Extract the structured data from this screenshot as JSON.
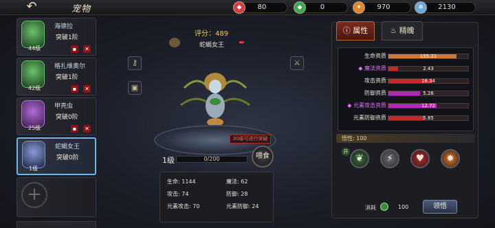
{
  "header": {
    "title": "宠物",
    "back_icon": "back-arrow-icon"
  },
  "resources": [
    {
      "icon": "red-gem-icon",
      "color": "#d93b3b",
      "value": "80"
    },
    {
      "icon": "green-gem-icon",
      "color": "#3ea84a",
      "value": "0"
    },
    {
      "icon": "flame-icon",
      "color": "#e0872a",
      "value": "970"
    },
    {
      "icon": "snowflake-icon",
      "color": "#6aa9d8",
      "value": "2130"
    }
  ],
  "pets": [
    {
      "name": "海德拉",
      "level": "44级",
      "break": "突破1阶",
      "avatar": "green"
    },
    {
      "name": "格扎维奥尔",
      "level": "42级",
      "break": "突破1阶",
      "avatar": "green"
    },
    {
      "name": "甲壳虫",
      "level": "25级",
      "break": "突破0阶",
      "avatar": "purple"
    },
    {
      "name": "蛇蝎女王",
      "level": "1级",
      "break": "突破0阶",
      "avatar": "blue"
    }
  ],
  "center": {
    "score": "评分：489",
    "pet_name": "蛇蝎女王",
    "breakthrough_tag": "30级可进行突破",
    "level": "1级",
    "exp": "0/200",
    "feed_label": "喂食"
  },
  "stats": {
    "hp": "生命: 1144",
    "mp": "魔法: 62",
    "atk": "攻击: 74",
    "def": "防御: 28",
    "elem_atk": "元素攻击: 70",
    "elem_def": "元素防御: 24"
  },
  "tabs": {
    "attributes": "属性",
    "spirit": "精魄"
  },
  "attributes": [
    {
      "label": "生命资质",
      "value": "155.21",
      "fill": 0.85,
      "color": "#c87a3a",
      "purple": false
    },
    {
      "label": "◆ 魔法资质",
      "value": "2.43",
      "fill": 0.12,
      "color": "#c02a2a",
      "purple": true
    },
    {
      "label": "攻击资质",
      "value": "16.34",
      "fill": 0.55,
      "color": "#c02a2a",
      "purple": false
    },
    {
      "label": "防御资质",
      "value": "5.26",
      "fill": 0.4,
      "color": "#b02ab8",
      "purple": false
    },
    {
      "label": "◆ 元素攻击资质",
      "value": "12.72",
      "fill": 0.6,
      "color": "#b02ab8",
      "purple": true
    },
    {
      "label": "元素防御资质",
      "value": "5.85",
      "fill": 0.45,
      "color": "#c02a2a",
      "purple": false
    }
  ],
  "comprehension": {
    "label": "悟性: 100"
  },
  "skills": {
    "open_label": "开"
  },
  "cost": {
    "label": "消耗",
    "value": "100",
    "button": "领悟"
  }
}
